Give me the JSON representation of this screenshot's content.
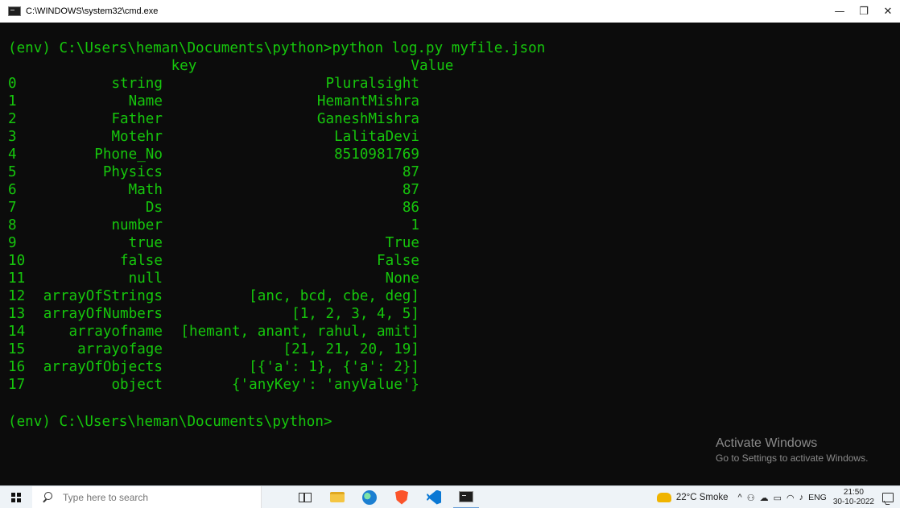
{
  "window": {
    "title": "C:\\WINDOWS\\system32\\cmd.exe",
    "minimize_glyph": "—",
    "maximize_glyph": "❐",
    "close_glyph": "✕"
  },
  "terminal": {
    "command_line": "(env) C:\\Users\\heman\\Documents\\python>python log.py myfile.json",
    "header": {
      "key": "key",
      "value": "Value"
    },
    "rows": [
      {
        "idx": "0",
        "key": "string",
        "value": "Pluralsight"
      },
      {
        "idx": "1",
        "key": "Name",
        "value": "HemantMishra"
      },
      {
        "idx": "2",
        "key": "Father",
        "value": "GaneshMishra"
      },
      {
        "idx": "3",
        "key": "Motehr",
        "value": "LalitaDevi"
      },
      {
        "idx": "4",
        "key": "Phone_No",
        "value": "8510981769"
      },
      {
        "idx": "5",
        "key": "Physics",
        "value": "87"
      },
      {
        "idx": "6",
        "key": "Math",
        "value": "87"
      },
      {
        "idx": "7",
        "key": "Ds",
        "value": "86"
      },
      {
        "idx": "8",
        "key": "number",
        "value": "1"
      },
      {
        "idx": "9",
        "key": "true",
        "value": "True"
      },
      {
        "idx": "10",
        "key": "false",
        "value": "False"
      },
      {
        "idx": "11",
        "key": "null",
        "value": "None"
      },
      {
        "idx": "12",
        "key": "arrayOfStrings",
        "value": "[anc, bcd, cbe, deg]"
      },
      {
        "idx": "13",
        "key": "arrayOfNumbers",
        "value": "[1, 2, 3, 4, 5]"
      },
      {
        "idx": "14",
        "key": "arrayofname",
        "value": "[hemant, anant, rahul, amit]"
      },
      {
        "idx": "15",
        "key": "arrayofage",
        "value": "[21, 21, 20, 19]"
      },
      {
        "idx": "16",
        "key": "arrayOfObjects",
        "value": "[{'a': 1}, {'a': 2}]"
      },
      {
        "idx": "17",
        "key": "object",
        "value": "{'anyKey': 'anyValue'}"
      }
    ],
    "prompt_line": "(env) C:\\Users\\heman\\Documents\\python>",
    "text_color": "#16c60c",
    "background": "#0c0c0c"
  },
  "watermark": {
    "title": "Activate Windows",
    "subtitle": "Go to Settings to activate Windows."
  },
  "taskbar": {
    "search_placeholder": "Type here to search",
    "apps": [
      "task-view",
      "file-explorer",
      "edge",
      "brave",
      "vscode",
      "command-prompt"
    ],
    "weather": "22°C  Smoke",
    "tray_chevron": "^",
    "language": "ENG",
    "time": "21:50",
    "date": "30-10-2022"
  }
}
